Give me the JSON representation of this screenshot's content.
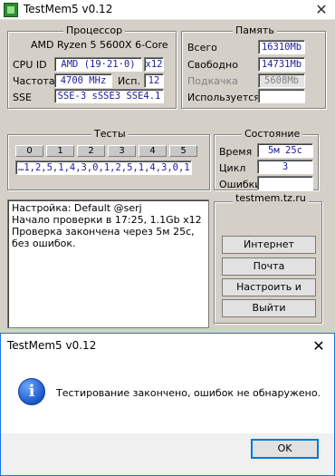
{
  "window": {
    "title": "TestMem5 v0.12",
    "close_glyph": "✕"
  },
  "processor": {
    "title": "Процессор",
    "name": "AMD Ryzen 5 5600X 6-Core",
    "cpu_id_label": "CPU ID",
    "cpu_id": "AMD (19·21·0)",
    "threads": "x12",
    "freq_label": "Частота",
    "freq": "4700 MHz",
    "used_label": "Исп.",
    "used": "12",
    "sse_label": "SSE",
    "sse": "SSE-3 sSSE3 SSE4.1"
  },
  "memory": {
    "title": "Память",
    "total_label": "Всего",
    "total": "16310Mb",
    "free_label": "Свободно",
    "free": "14731Mb",
    "swap_label": "Подкачка",
    "swap": "5608Mb",
    "used_label": "Используется",
    "used": ""
  },
  "tests": {
    "title": "Тесты",
    "cells": [
      "0",
      "1",
      "2",
      "3",
      "4",
      "5"
    ],
    "sequence": "…1,2,5,1,4,3,0,1,2,5,1,4,3,0,1"
  },
  "status": {
    "title": "Состояние",
    "time_label": "Время",
    "time": "5м 25с",
    "cycle_label": "Цикл",
    "cycle": "3",
    "errors_label": "Ошибки",
    "errors": ""
  },
  "log": [
    "Настройка: Default @serj",
    "Начало проверки в 17:25, 1.1Gb x12",
    "Проверка закончена через 5м 25с,",
    "без ошибок."
  ],
  "links": {
    "title": "testmem.tz.ru",
    "buttons": [
      "Интернет",
      "Почта",
      "Настроить и выйти",
      "Выйти"
    ]
  },
  "dialog": {
    "title": "TestMem5 v0.12",
    "close_glyph": "✕",
    "icon": "info-icon",
    "icon_glyph": "i",
    "message": "Тестирование закончено, ошибок не обнаружено.",
    "ok_label": "OK"
  }
}
